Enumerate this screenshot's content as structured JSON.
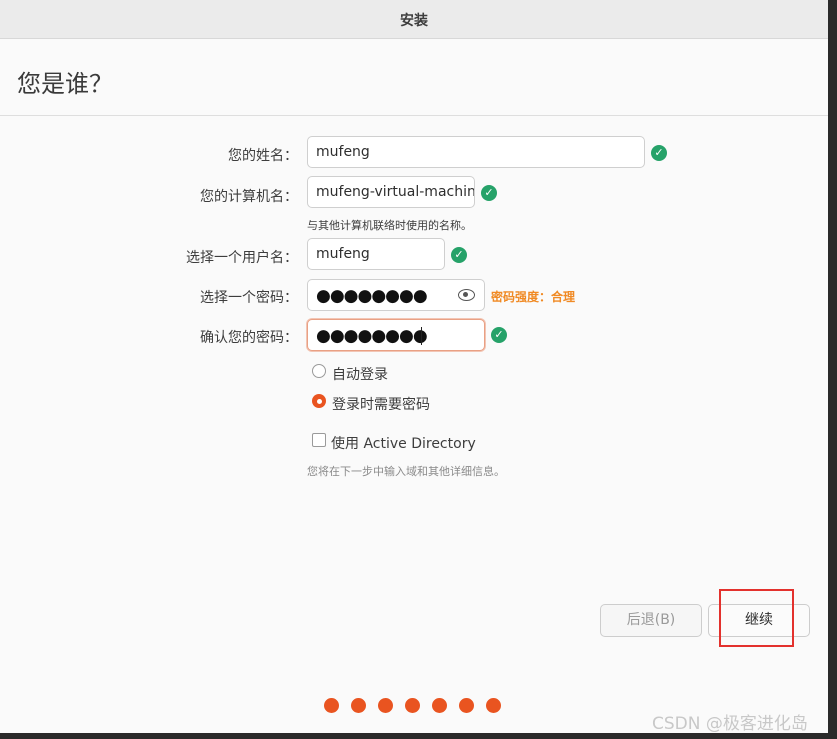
{
  "window": {
    "title": "安装"
  },
  "page": {
    "title": "您是谁？"
  },
  "form": {
    "name": {
      "label": "您的姓名：",
      "value": "mufeng"
    },
    "computer": {
      "label": "您的计算机名：",
      "value": "mufeng-virtual-machin",
      "hint": "与其他计算机联络时使用的名称。"
    },
    "username": {
      "label": "选择一个用户名：",
      "value": "mufeng"
    },
    "password": {
      "label": "选择一个密码：",
      "value": "●●●●●●●●",
      "strength": "密码强度：合理"
    },
    "confirm": {
      "label": "确认您的密码：",
      "value": "●●●●●●●●"
    },
    "login_options": [
      {
        "label": "自动登录",
        "selected": false
      },
      {
        "label": "登录时需要密码",
        "selected": true
      }
    ],
    "active_directory": {
      "label": "使用 Active Directory",
      "checked": false,
      "hint": "您将在下一步中输入域和其他详细信息。"
    }
  },
  "buttons": {
    "back": "后退(B)",
    "continue": "继续"
  },
  "progress": {
    "total_steps": 7,
    "accent": "#e95420"
  },
  "watermark": "CSDN @极客进化岛",
  "colors": {
    "accent": "#e95420",
    "check": "#26a269",
    "strength": "#f08a24"
  },
  "icons": {
    "valid": "check-circle-icon",
    "reveal": "eye-icon"
  }
}
